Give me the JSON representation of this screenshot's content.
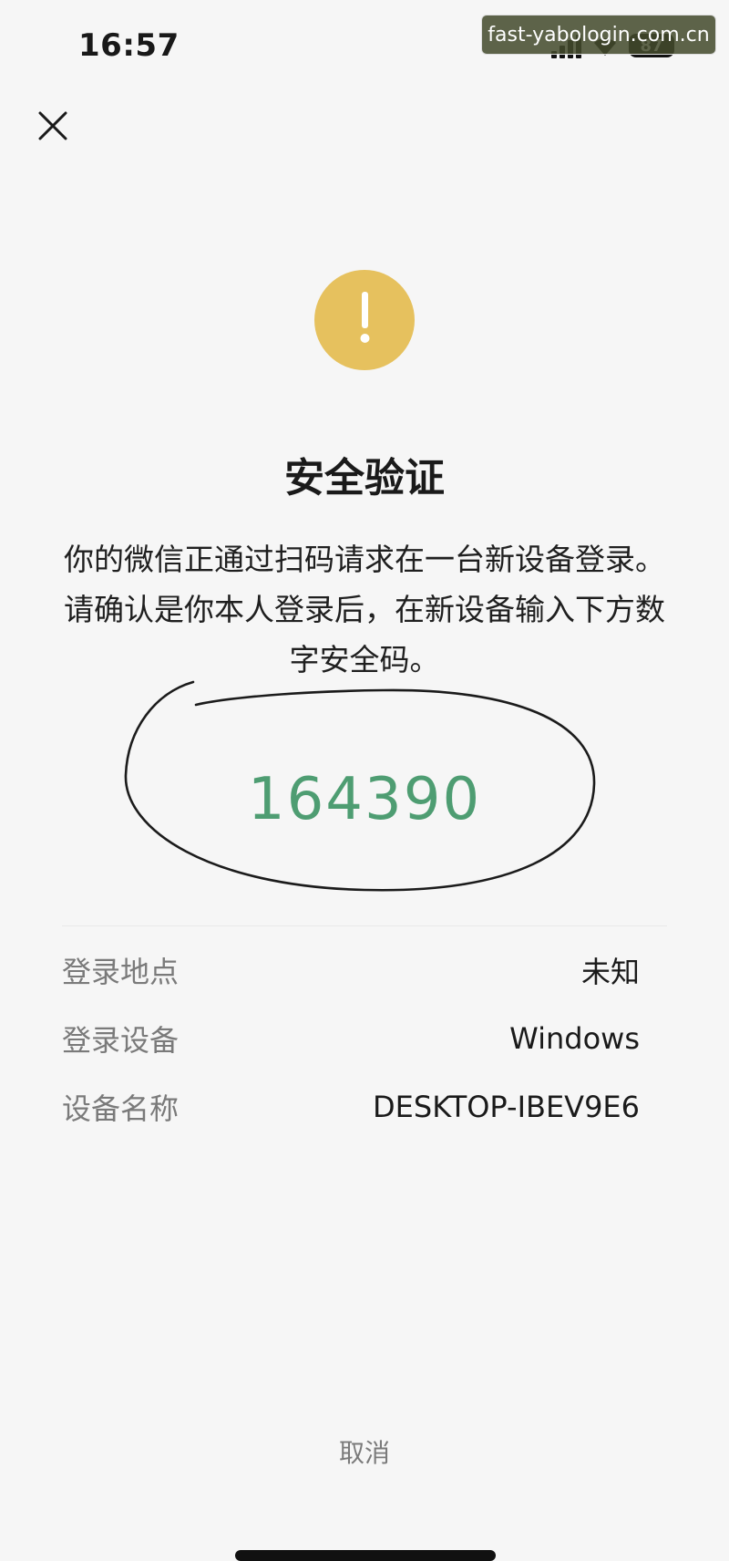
{
  "status_bar": {
    "time": "16:57",
    "battery": "87"
  },
  "watermark": {
    "text": "fast-yabologin.com.cn"
  },
  "header": {
    "close_icon": "close-icon"
  },
  "warning": {
    "icon": "exclamation-icon",
    "color": "#e6c15e"
  },
  "title": "安全验证",
  "description": "你的微信正通过扫码请求在一台新设备登录。请确认是你本人登录后，在新设备输入下方数字安全码。",
  "security_code": "164390",
  "info": [
    {
      "label": "登录地点",
      "value": "未知"
    },
    {
      "label": "登录设备",
      "value": "Windows"
    },
    {
      "label": "设备名称",
      "value": "DESKTOP-IBEV9E6"
    }
  ],
  "cancel_label": "取消",
  "colors": {
    "code": "#4e9d72",
    "label": "#7a7a7a"
  }
}
